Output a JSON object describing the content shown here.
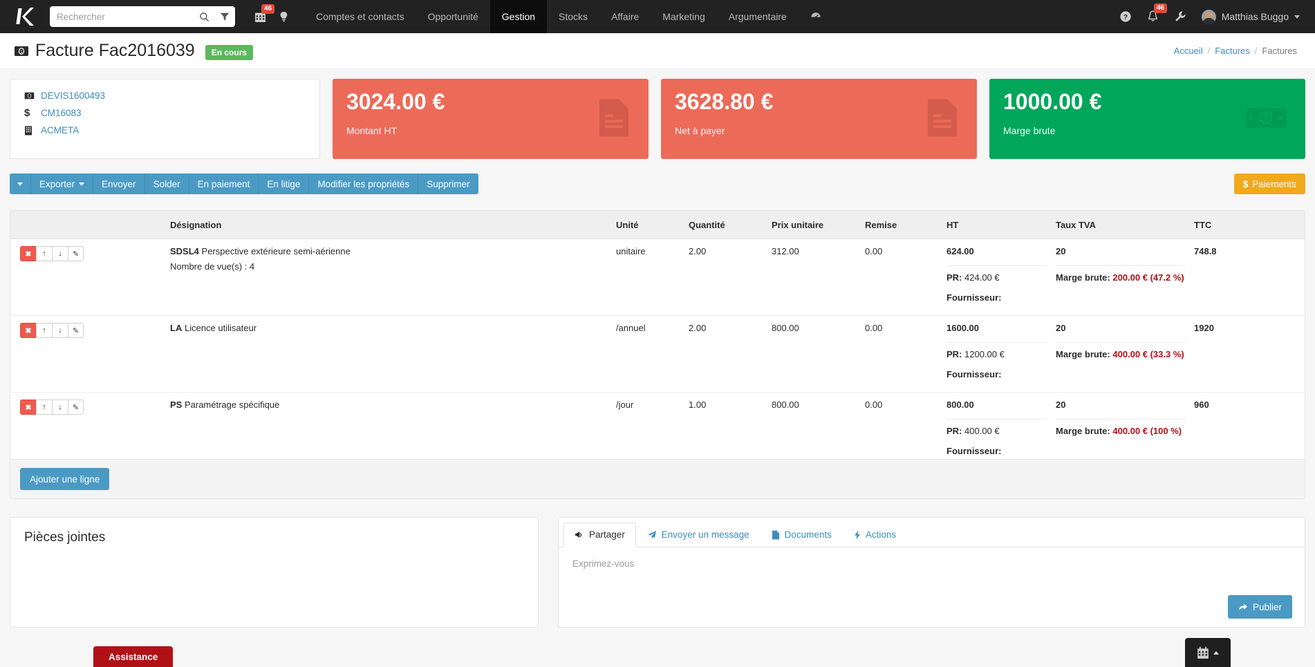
{
  "navbar": {
    "brand_icon": "k-logo-icon",
    "search": {
      "placeholder": "Rechercher",
      "value": ""
    },
    "quick_icons": [
      {
        "name": "calendar-icon",
        "badge": "46"
      },
      {
        "name": "lightbulb-icon",
        "badge": ""
      }
    ],
    "links": [
      {
        "label": "Comptes et contacts",
        "active": false
      },
      {
        "label": "Opportunité",
        "active": false
      },
      {
        "label": "Gestion",
        "active": true
      },
      {
        "label": "Stocks",
        "active": false
      },
      {
        "label": "Affaire",
        "active": false
      },
      {
        "label": "Marketing",
        "active": false
      },
      {
        "label": "Argumentaire",
        "active": false
      }
    ],
    "dashboard_icon": "speedometer-icon",
    "right": {
      "help_icon": "help-circle-icon",
      "bell_icon": "bell-icon",
      "bell_badge": "46",
      "wrench_icon": "wrench-icon",
      "user_name": "Matthias Buggo"
    }
  },
  "header": {
    "icon": "invoice-money-icon",
    "title": "Facture Fac2016039",
    "status": "En cours",
    "breadcrumb": [
      {
        "label": "Accueil",
        "link": true
      },
      {
        "label": "Factures",
        "link": true
      },
      {
        "label": "Factures",
        "link": false
      }
    ],
    "breadcrumb_separator": "/"
  },
  "info_card": {
    "links": [
      {
        "icon": "invoice-money-icon",
        "label": "DEVIS1600493"
      },
      {
        "icon": "dollar-icon",
        "label": "CM16083"
      },
      {
        "icon": "building-icon",
        "label": "ACMETA"
      }
    ]
  },
  "kpis": [
    {
      "value": "3024.00 €",
      "label": "Montant HT",
      "color": "#ec6a58",
      "icon": "document-icon"
    },
    {
      "value": "3628.80 €",
      "label": "Net à payer",
      "color": "#ec6a58",
      "icon": "document-icon"
    },
    {
      "value": "1000.00 €",
      "label": "Marge brute",
      "color": "#00a65a",
      "icon": "money-bill-icon"
    }
  ],
  "toolbar": {
    "dropdown_caret": "caret-down-icon",
    "buttons": [
      {
        "label": "Exporter",
        "caret": true
      },
      {
        "label": "Envoyer",
        "caret": false
      },
      {
        "label": "Solder",
        "caret": false
      },
      {
        "label": "En paiement",
        "caret": false
      },
      {
        "label": "En litige",
        "caret": false
      },
      {
        "label": "Modifier les propriétés",
        "caret": false
      },
      {
        "label": "Supprimer",
        "caret": false
      }
    ],
    "payments_label": "Paiements",
    "payments_icon": "dollar-icon",
    "payments_color": "#f0a91d"
  },
  "lines_table": {
    "columns": [
      "",
      "Désignation",
      "Unité",
      "Quantité",
      "Prix unitaire",
      "Remise",
      "HT",
      "Taux TVA",
      "TTC"
    ],
    "row_actions": [
      {
        "name": "delete-line-button",
        "glyph": "✖"
      },
      {
        "name": "move-up-button",
        "glyph": "↑"
      },
      {
        "name": "move-down-button",
        "glyph": "↓"
      },
      {
        "name": "edit-line-button",
        "glyph": "✎"
      }
    ],
    "labels": {
      "pr": "PR:",
      "marge": "Marge brute:",
      "fournisseur": "Fournisseur:"
    },
    "rows": [
      {
        "code": "SDSL4",
        "designation": "Perspective extérieure semi-aérienne",
        "note": "Nombre de vue(s) :  4",
        "unite": "unitaire",
        "quantite": "2.00",
        "prix_unitaire": "312.00",
        "remise": "0.00",
        "ht": "624.00",
        "taux_tva": "20",
        "ttc": "748.8",
        "pr_value": "424.00 €",
        "marge_value": "200.00 € (47.2 %)",
        "fournisseur_value": ""
      },
      {
        "code": "LA",
        "designation": "Licence utilisateur",
        "note": "",
        "unite": "/annuel",
        "quantite": "2.00",
        "prix_unitaire": "800.00",
        "remise": "0.00",
        "ht": "1600.00",
        "taux_tva": "20",
        "ttc": "1920",
        "pr_value": "1200.00 €",
        "marge_value": "400.00 € (33.3 %)",
        "fournisseur_value": ""
      },
      {
        "code": "PS",
        "designation": "Paramétrage spécifique",
        "note": "",
        "unite": "/jour",
        "quantite": "1.00",
        "prix_unitaire": "800.00",
        "remise": "0.00",
        "ht": "800.00",
        "taux_tva": "20",
        "ttc": "960",
        "pr_value": "400.00 €",
        "marge_value": "400.00 € (100 %)",
        "fournisseur_value": ""
      }
    ],
    "add_line_label": "Ajouter une ligne"
  },
  "attachments": {
    "title": "Pièces jointes"
  },
  "social": {
    "tabs": [
      {
        "label": "Partager",
        "icon": "megaphone-icon",
        "active": true
      },
      {
        "label": "Envoyer un message",
        "icon": "paper-plane-icon",
        "active": false
      },
      {
        "label": "Documents",
        "icon": "file-icon",
        "active": false
      },
      {
        "label": "Actions",
        "icon": "bolt-icon",
        "active": false
      }
    ],
    "composer_placeholder": "Exprimez-vous",
    "publish_label": "Publier",
    "publish_icon": "share-icon"
  },
  "floating": {
    "assistance_label": "Assistance",
    "assistance_color": "#b01116",
    "chat_icon": "calendar-icon",
    "chat_chevron": "chevron-up-icon"
  }
}
